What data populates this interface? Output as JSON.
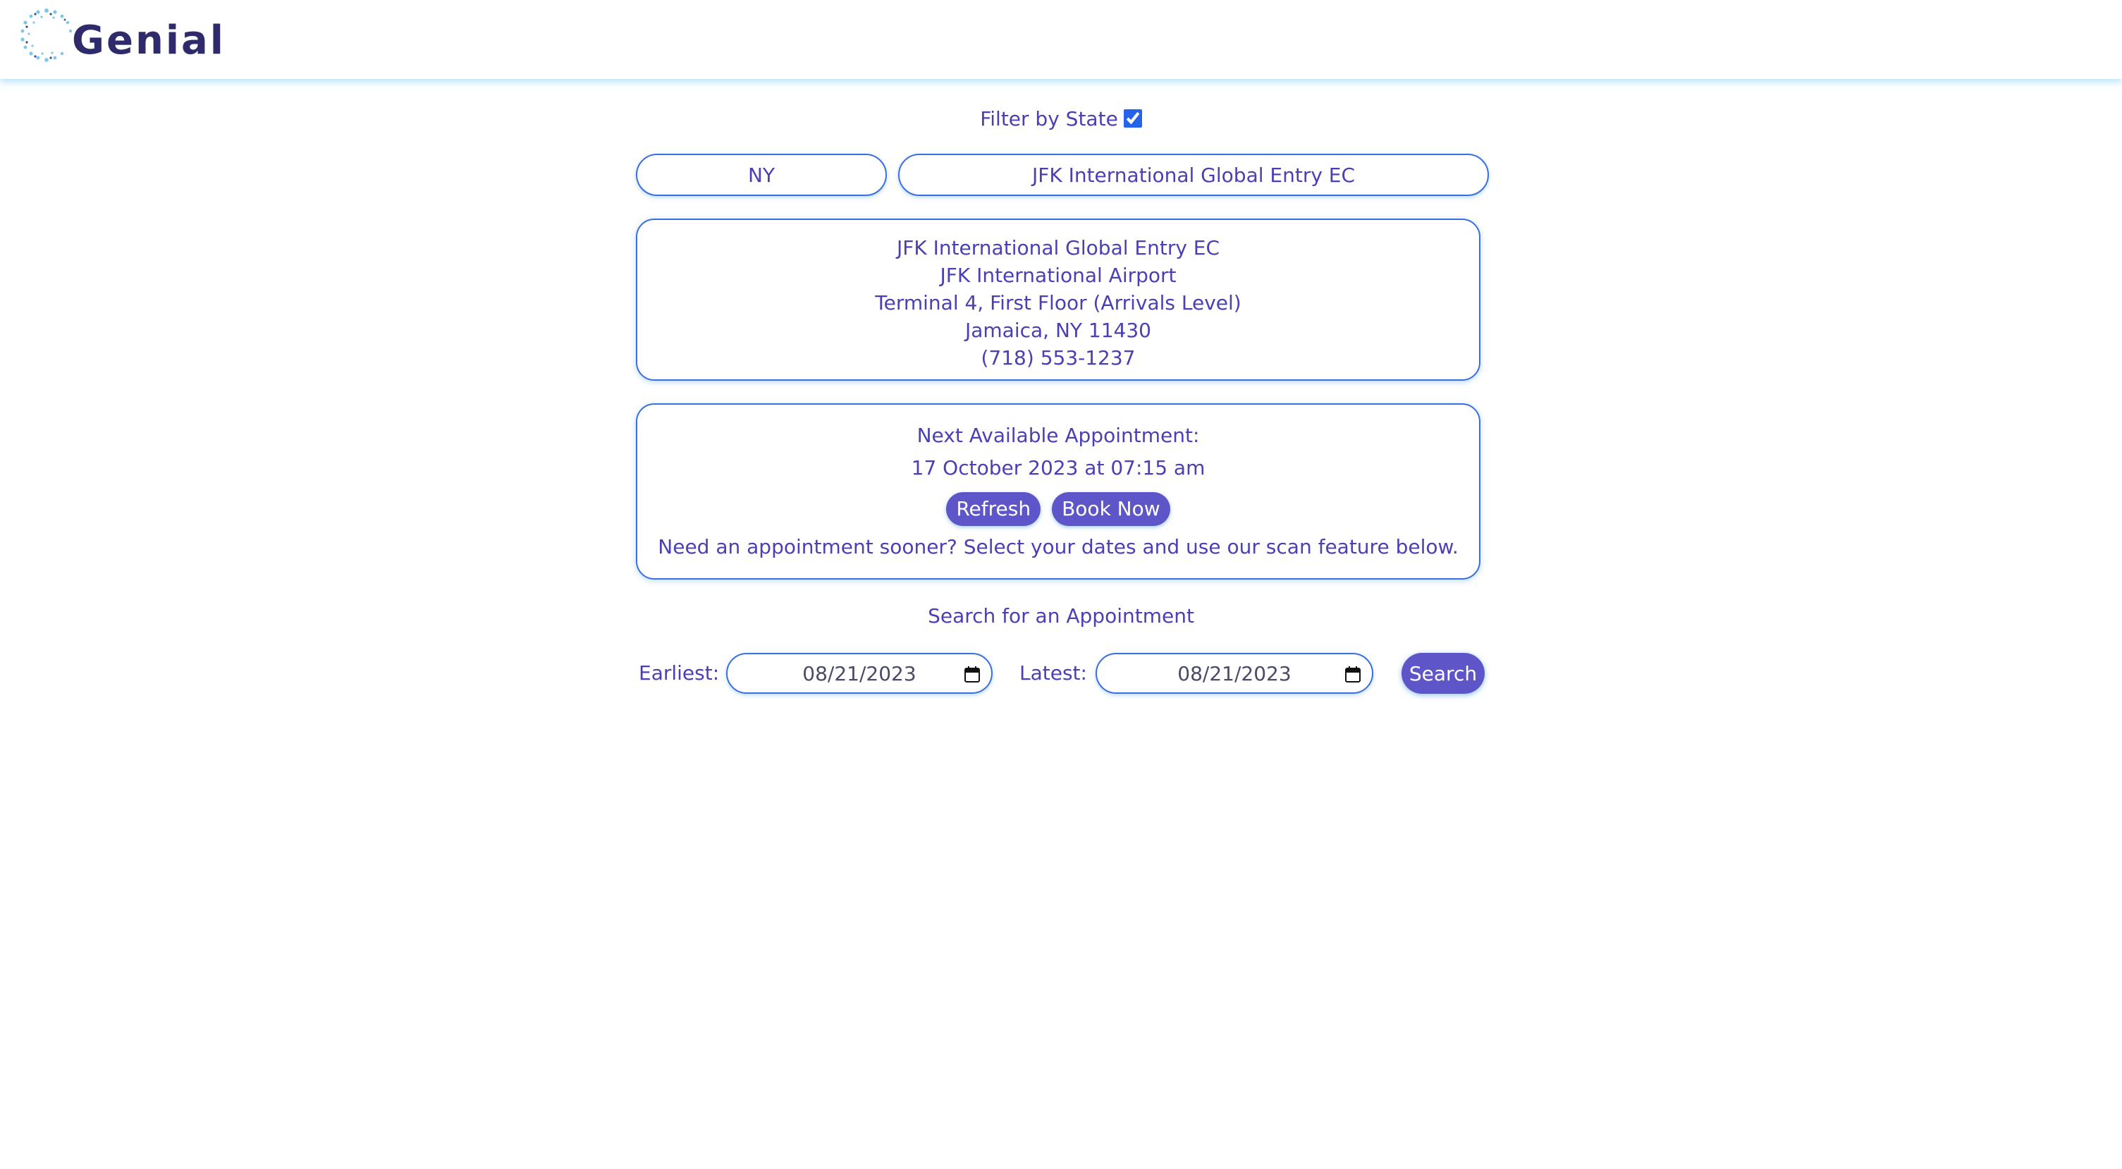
{
  "header": {
    "app_name": "Genial"
  },
  "filter": {
    "label": "Filter by State",
    "checked": true
  },
  "selectors": {
    "state": "NY",
    "enrollment_center": "JFK International Global Entry EC"
  },
  "location": {
    "lines": [
      "JFK International Global Entry EC",
      "JFK International Airport",
      "Terminal 4, First Floor (Arrivals Level)",
      "Jamaica, NY 11430",
      "(718) 553-1237"
    ]
  },
  "appointment": {
    "title": "Next Available Appointment:",
    "date": "17 October 2023 at 07:15 am",
    "refresh_label": "Refresh",
    "book_label": "Book Now",
    "note": "Need an appointment sooner? Select your dates and use our scan feature below."
  },
  "search": {
    "title": "Search for an Appointment",
    "earliest_label": "Earliest:",
    "earliest_value": "08/21/2023",
    "latest_label": "Latest:",
    "latest_value": "08/21/2023",
    "button_label": "Search"
  },
  "colors": {
    "accent": "#5e55c9",
    "text": "#4a3fb4",
    "border": "#3b6fe0",
    "logo_text": "#2f2a6b",
    "logo_dots": "#7cc8ec"
  },
  "icons": {
    "logo": "dotted-circle-logo-icon",
    "date_picker": "calendar-icon"
  }
}
